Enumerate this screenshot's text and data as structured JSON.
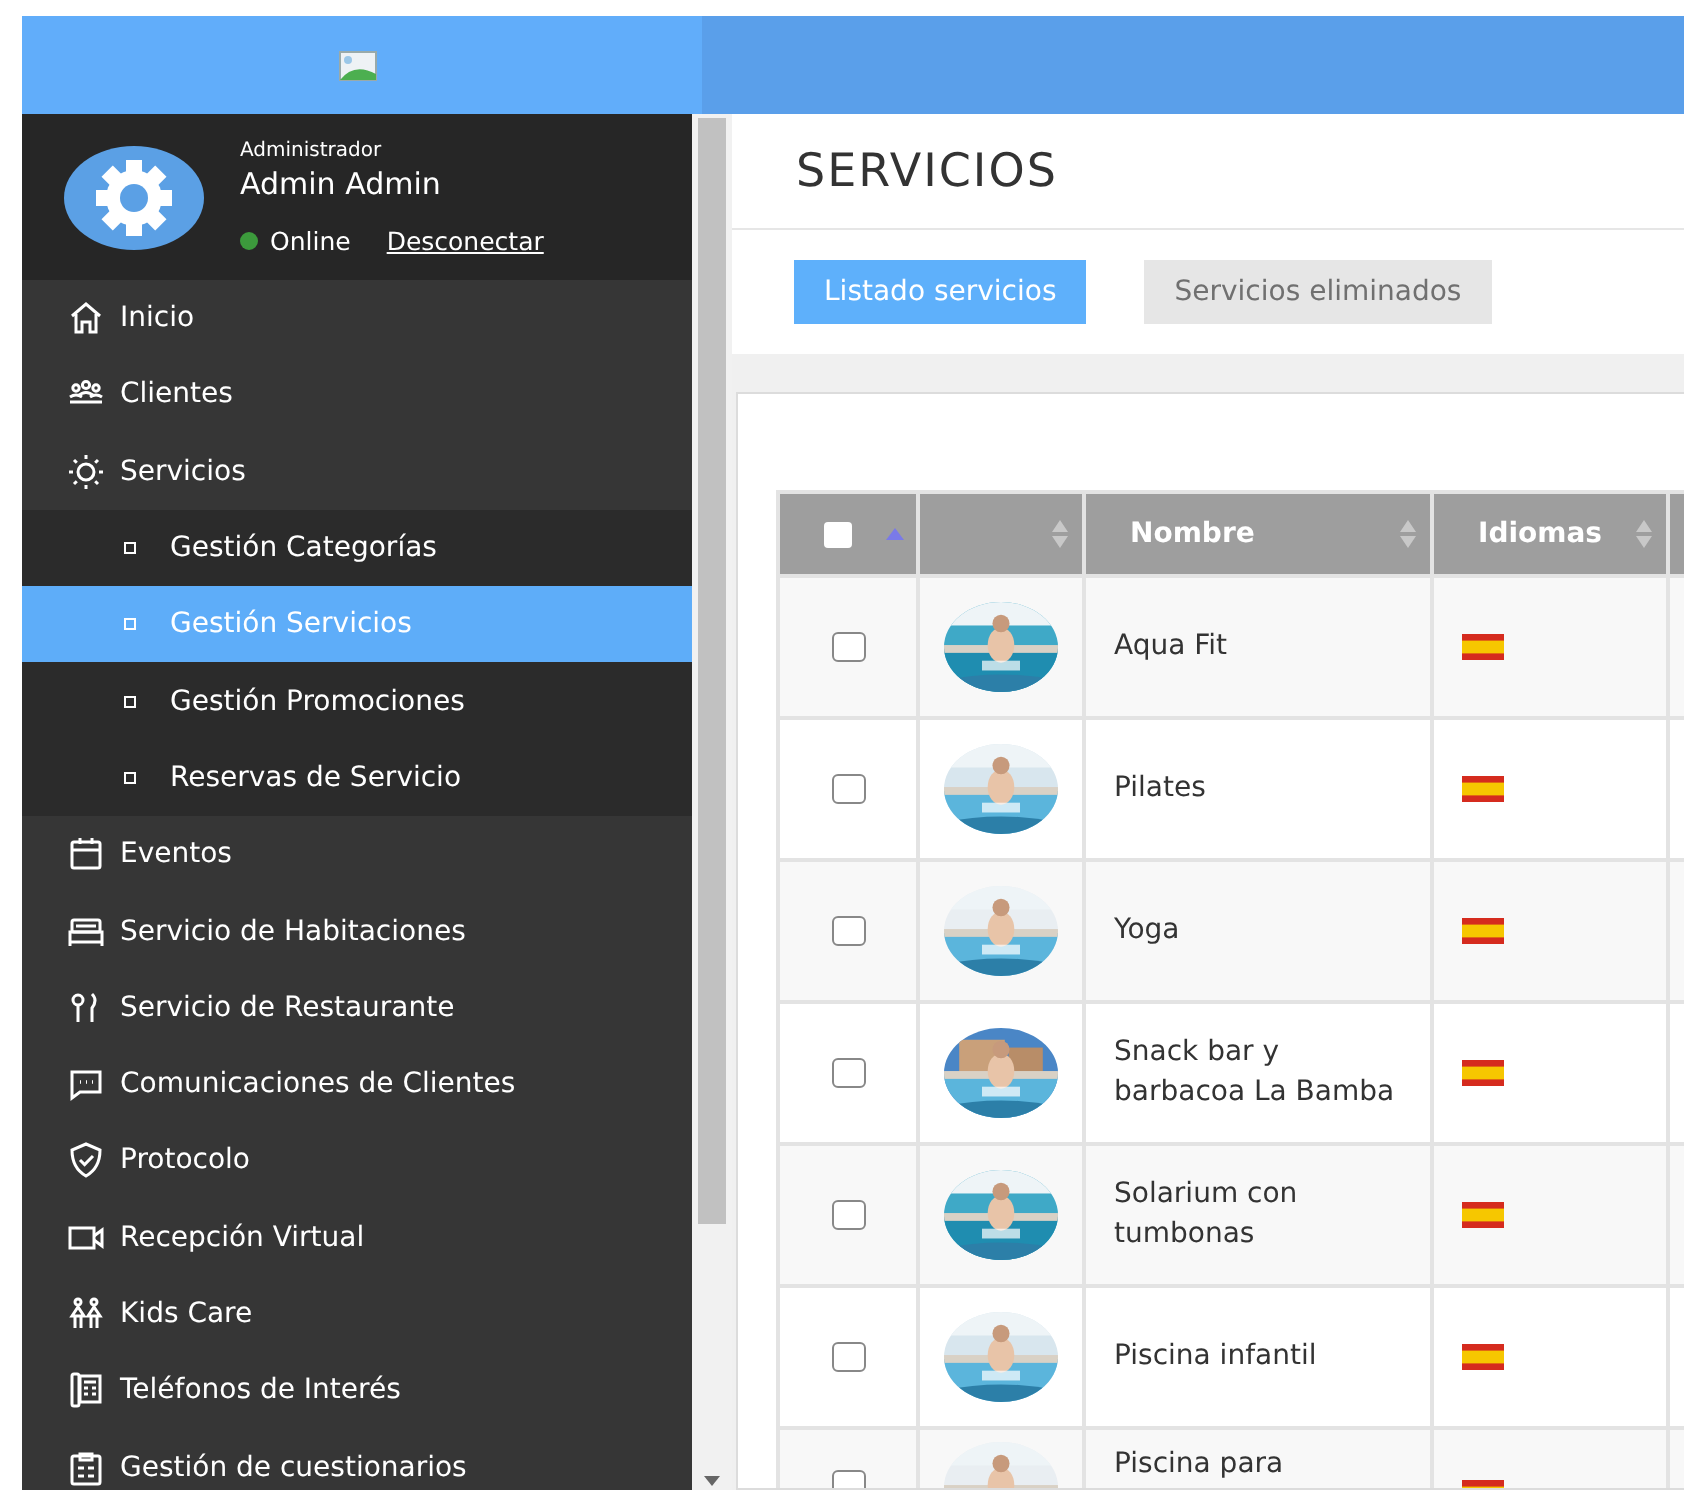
{
  "user": {
    "role": "Administrador",
    "name": "Admin Admin",
    "status": "Online",
    "logout_link": "Desconectar"
  },
  "sidebar": {
    "items": [
      {
        "label": "Inicio",
        "selected": false
      },
      {
        "label": "Clientes",
        "selected": false
      },
      {
        "label": "Servicios",
        "selected": false,
        "children": [
          {
            "label": "Gestión Categorías",
            "selected": false
          },
          {
            "label": "Gestión Servicios",
            "selected": true
          },
          {
            "label": "Gestión Promociones",
            "selected": false
          },
          {
            "label": "Reservas de Servicio",
            "selected": false
          }
        ]
      },
      {
        "label": "Eventos",
        "selected": false
      },
      {
        "label": "Servicio de Habitaciones",
        "selected": false
      },
      {
        "label": "Servicio de Restaurante",
        "selected": false
      },
      {
        "label": "Comunicaciones de Clientes",
        "selected": false
      },
      {
        "label": "Protocolo",
        "selected": false
      },
      {
        "label": "Recepción Virtual",
        "selected": false
      },
      {
        "label": "Kids Care",
        "selected": false
      },
      {
        "label": "Teléfonos de Interés",
        "selected": false
      },
      {
        "label": "Gestión de cuestionarios",
        "selected": false
      }
    ]
  },
  "page": {
    "title": "SERVICIOS",
    "tabs": [
      {
        "label": "Listado servicios",
        "selected": true
      },
      {
        "label": "Servicios eliminados",
        "selected": false
      }
    ]
  },
  "table": {
    "select_all_checked": false,
    "columns": [
      {
        "sorted_ascending": true
      },
      {
        "sorted_ascending": false
      },
      {
        "label": "Nombre",
        "sorted_ascending": false
      },
      {
        "label": "Idiomas",
        "sorted_ascending": false
      }
    ],
    "rows": [
      {
        "checked": false,
        "name": "Aqua Fit"
      },
      {
        "checked": false,
        "name": "Pilates"
      },
      {
        "checked": false,
        "name": "Yoga"
      },
      {
        "checked": false,
        "name": "Snack bar y barbacoa La Bamba"
      },
      {
        "checked": false,
        "name": "Solarium con tumbonas"
      },
      {
        "checked": false,
        "name": "Piscina infantil"
      },
      {
        "checked": false,
        "name": "Piscina para"
      }
    ]
  }
}
